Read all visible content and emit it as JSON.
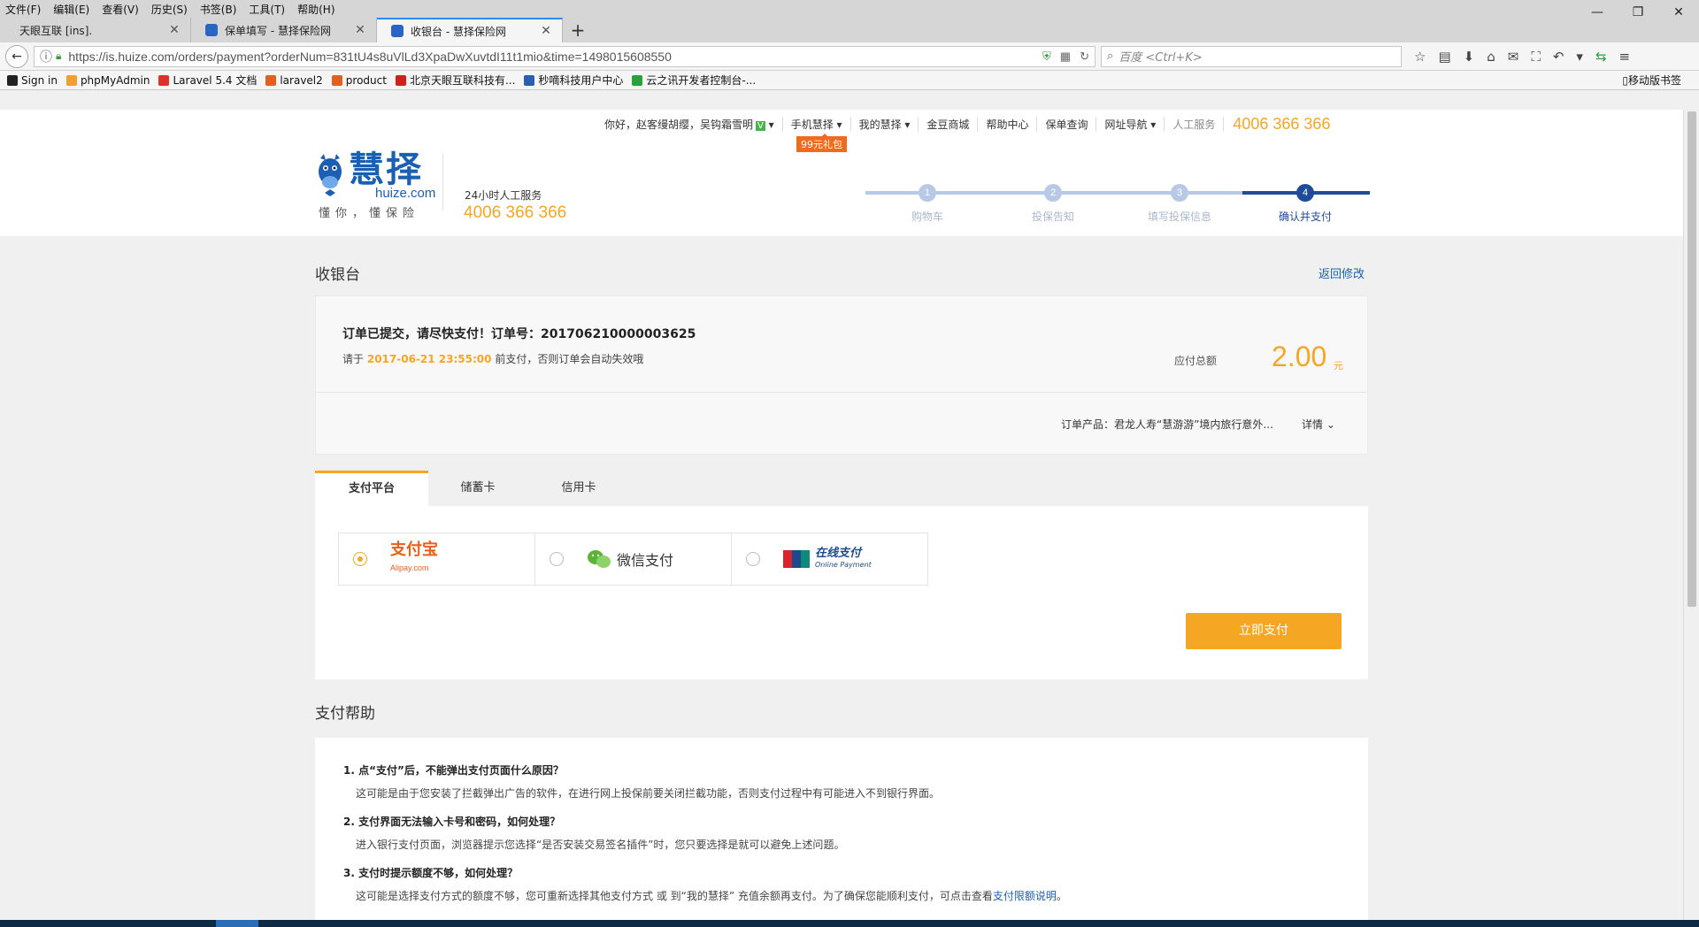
{
  "browser": {
    "menu": [
      "文件(F)",
      "编辑(E)",
      "查看(V)",
      "历史(S)",
      "书签(B)",
      "工具(T)",
      "帮助(H)"
    ],
    "window_controls": [
      "—",
      "❐",
      "✕"
    ],
    "tabs": [
      {
        "title": "天眼互联 [ins]."
      },
      {
        "title": "保单填写 - 慧择保险网"
      },
      {
        "title": "收银台 - 慧择保险网"
      }
    ],
    "tab_close": "✕",
    "new_tab": "+",
    "url": "https://is.huize.com/orders/payment?orderNum=831tU4s8uVlLd3XpaDwXuvtdI11t1mio&time=1498015608550",
    "search_placeholder": "百度 <Ctrl+K>",
    "bookmarks": [
      {
        "label": "Sign in",
        "color": "#222222"
      },
      {
        "label": "phpMyAdmin",
        "color": "#f0a030"
      },
      {
        "label": "Laravel 5.4 文档",
        "color": "#e0302a"
      },
      {
        "label": "laravel2",
        "color": "#e06020"
      },
      {
        "label": "product",
        "color": "#e06020"
      },
      {
        "label": "北京天眼互联科技有...",
        "color": "#d0201a"
      },
      {
        "label": "秒嘀科技用户中心",
        "color": "#2a5fb0"
      },
      {
        "label": "云之讯开发者控制台-...",
        "color": "#2aa040"
      }
    ],
    "mobile_bookmarks": "移动版书签"
  },
  "header": {
    "topnav": {
      "greeting": "你好，赵客缦胡缨，吴钩霜雪明",
      "items": [
        "手机慧择",
        "我的慧择",
        "金豆商城",
        "帮助中心",
        "保单查询",
        "网址导航"
      ],
      "service_label": "人工服务",
      "hotline": "4006 366 366",
      "gift_badge": "99元礼包"
    },
    "logo": {
      "cn": "慧择",
      "en": "huize.com",
      "slogan": "懂你，懂保险"
    },
    "service": {
      "label": "24小时人工服务",
      "phone": "4006 366 366"
    },
    "steps": [
      {
        "num": "1",
        "label": "购物车"
      },
      {
        "num": "2",
        "label": "投保告知"
      },
      {
        "num": "3",
        "label": "填写投保信息"
      },
      {
        "num": "4",
        "label": "确认并支付"
      }
    ]
  },
  "cashier": {
    "title": "收银台",
    "back_link": "返回修改",
    "order": {
      "title": "订单已提交，请尽快支付！订单号：201706210000003625",
      "deadline_prefix": "请于",
      "deadline_time": "2017-06-21 23:55:00",
      "deadline_suffix": "前支付，否则订单会自动失效哦",
      "total_label": "应付总额",
      "amount": "2.00",
      "unit": "元",
      "product": "订单产品：君龙人寿“慧游游”境内旅行意外...",
      "detail": "详情"
    },
    "pay_tabs": [
      "支付平台",
      "储蓄卡",
      "信用卡"
    ],
    "methods": {
      "alipay": "支付宝",
      "alipay_sub": "Alipay.com",
      "wechat": "微信支付",
      "union": "在线支付",
      "union_sub": "Online Payment"
    },
    "pay_button": "立即支付"
  },
  "help": {
    "title": "支付帮助",
    "items": [
      {
        "q": "1. 点“支付”后，不能弹出支付页面什么原因？",
        "a": "这可能是由于您安装了拦截弹出广告的软件，在进行网上投保前要关闭拦截功能，否则支付过程中有可能进入不到银行界面。"
      },
      {
        "q": "2. 支付界面无法输入卡号和密码，如何处理？",
        "a": "进入银行支付页面，浏览器提示您选择“是否安装交易签名插件”时，您只要选择是就可以避免上述问题。"
      },
      {
        "q": "3. 支付时提示额度不够，如何处理？",
        "a": "这可能是选择支付方式的额度不够，您可重新选择其他支付方式 或 到“我的慧择” 充值余额再支付。为了确保您能顺利支付，可点击查看",
        "link": "支付限额说明",
        "end": "。"
      }
    ]
  }
}
